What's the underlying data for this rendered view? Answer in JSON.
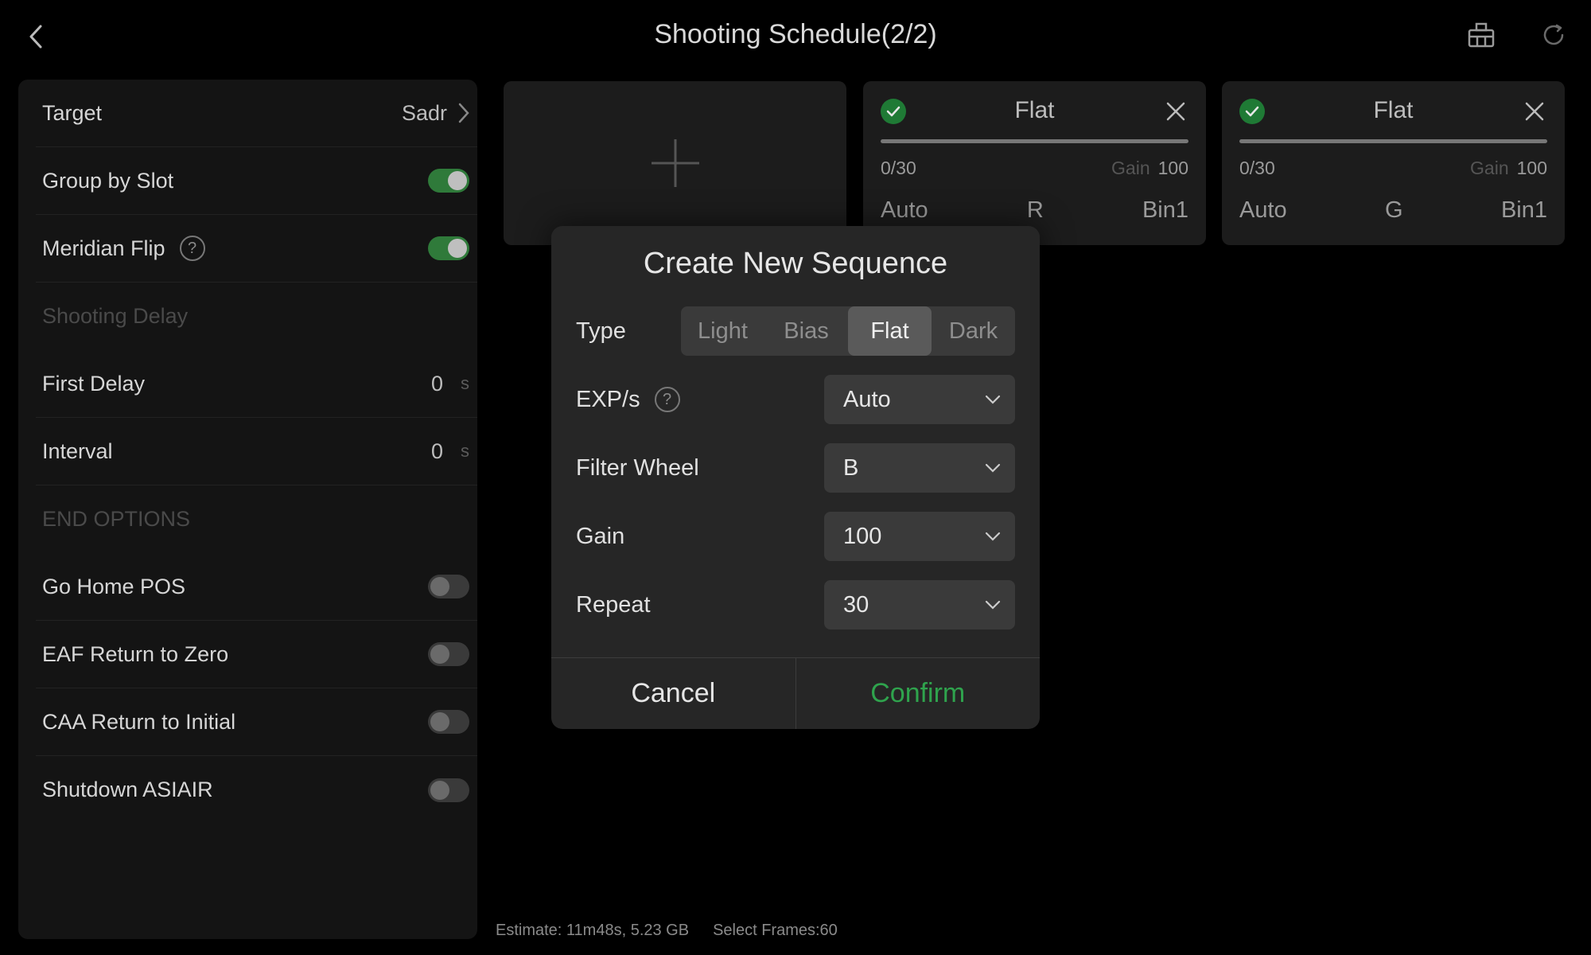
{
  "header": {
    "title": "Shooting Schedule(2/2)",
    "icons": [
      "back-icon",
      "plan-icon",
      "refresh-icon"
    ]
  },
  "settings": {
    "target": {
      "label": "Target",
      "value": "Sadr"
    },
    "group_by_slot": {
      "label": "Group by Slot",
      "on": true
    },
    "meridian_flip": {
      "label": "Meridian Flip",
      "help": "?",
      "on": true
    },
    "shooting_delay_header": "Shooting Delay",
    "first_delay": {
      "label": "First Delay",
      "value": "0",
      "unit": "s"
    },
    "interval": {
      "label": "Interval",
      "value": "0",
      "unit": "s"
    },
    "end_options_header": "END OPTIONS",
    "go_home": {
      "label": "Go Home POS",
      "on": false
    },
    "eaf_return": {
      "label": "EAF Return to Zero",
      "on": false
    },
    "caa_return": {
      "label": "CAA Return to Initial",
      "on": false
    },
    "shutdown": {
      "label": "Shutdown ASIAIR",
      "on": false
    }
  },
  "cards": [
    {
      "title": "Flat",
      "progress": "0/30",
      "progress_fraction": 0,
      "gain_label": "Gain",
      "gain": "100",
      "exposure": "Auto",
      "filter": "R",
      "bin": "Bin1"
    },
    {
      "title": "Flat",
      "progress": "0/30",
      "progress_fraction": 0,
      "gain_label": "Gain",
      "gain": "100",
      "exposure": "Auto",
      "filter": "G",
      "bin": "Bin1"
    }
  ],
  "footer": {
    "estimate": "Estimate: 11m48s, 5.23 GB",
    "select_frames": "Select Frames:60"
  },
  "dialog": {
    "title": "Create New Sequence",
    "type_label": "Type",
    "types": [
      "Light",
      "Bias",
      "Flat",
      "Dark"
    ],
    "selected_type": "Flat",
    "exp_label": "EXP/s",
    "exp_help": "?",
    "exp_value": "Auto",
    "filter_label": "Filter Wheel",
    "filter_value": "B",
    "gain_label": "Gain",
    "gain_value": "100",
    "repeat_label": "Repeat",
    "repeat_value": "30",
    "cancel": "Cancel",
    "confirm": "Confirm"
  },
  "colors": {
    "accent_green": "#2fa34d",
    "toggle_on": "#2f7a3a",
    "background": "#000000",
    "panel": "#141414"
  }
}
